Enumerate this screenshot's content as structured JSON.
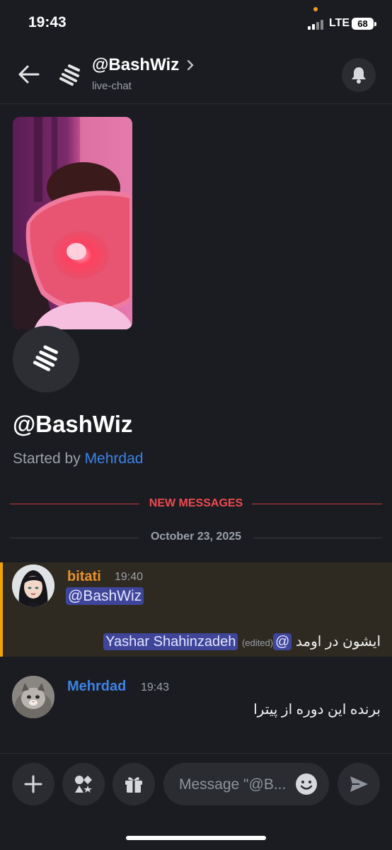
{
  "status_bar": {
    "time": "19:43",
    "network": "LTE",
    "battery": "68"
  },
  "header": {
    "title": "@BashWiz",
    "subtitle": "live-chat"
  },
  "thread": {
    "title": "@BashWiz",
    "started_prefix": "Started by ",
    "started_by": "Mehrdad"
  },
  "separators": {
    "new_messages": "NEW MESSAGES",
    "date": "October 23, 2025"
  },
  "messages": [
    {
      "author": "bitati",
      "time": "19:40",
      "mention": "@BashWiz",
      "line2_text": "ایشون در اومد",
      "line2_at": "@",
      "edited": "(edited)",
      "line2_mention": "Yashar Shahinzadeh"
    },
    {
      "author": "Mehrdad",
      "time": "19:43",
      "text": "برنده این دوره از پیترا"
    }
  ],
  "composer": {
    "placeholder": "Message \"@B..."
  },
  "colors": {
    "background": "#1b1c21",
    "accent_link": "#3d82e6",
    "new_messages": "#ef4a50",
    "highlight_bar": "#f0a500",
    "author_orange": "#e8902a",
    "mention_bg": "#3f4599"
  },
  "icons": [
    "back-arrow-icon",
    "thread-icon",
    "chevron-right-icon",
    "bell-icon",
    "plus-icon",
    "apps-icon",
    "gift-icon",
    "emoji-icon",
    "send-icon"
  ]
}
